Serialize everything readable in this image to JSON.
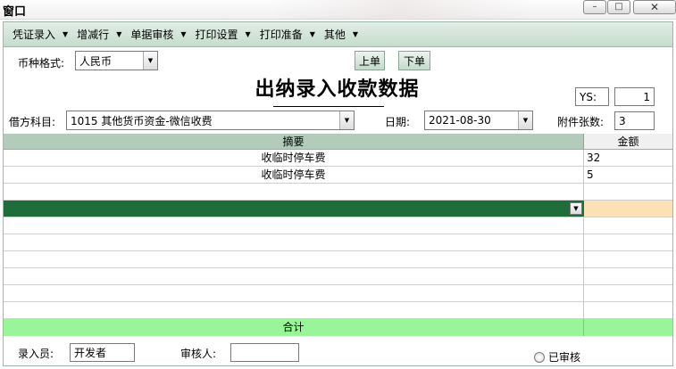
{
  "window": {
    "title": "窗口"
  },
  "menu": {
    "items": [
      {
        "label": "凭证录入"
      },
      {
        "label": "增减行"
      },
      {
        "label": "单据审核"
      },
      {
        "label": "打印设置"
      },
      {
        "label": "打印准备"
      },
      {
        "label": "其他"
      }
    ]
  },
  "header": {
    "currency_label": "币种格式:",
    "currency_value": "人民币",
    "prev_label": "上单",
    "next_label": "下单",
    "page_title": "出纳录入收款数据",
    "ys_label": "YS:",
    "ys_value": "1",
    "debit_label": "借方科目:",
    "debit_value": "1015 其他货币资金-微信收费",
    "date_label": "日期:",
    "date_value": "2021-08-30",
    "attach_label": "附件张数:",
    "attach_value": "3"
  },
  "grid": {
    "columns": [
      "摘要",
      "金额"
    ],
    "rows": [
      {
        "summary": "收临时停车费",
        "amount": "32"
      },
      {
        "summary": "收临时停车费",
        "amount": "5"
      }
    ],
    "total_label": "合计"
  },
  "footer": {
    "entry_label": "录入员:",
    "entry_value": "开发者",
    "reviewer_label": "审核人:",
    "reviewer_value": "",
    "reviewed_label": "已审核"
  },
  "colors": {
    "menu_bg": "#c7dccd",
    "active_row": "#1f6d3a",
    "active_cell": "#fde1b6",
    "total_row": "#98f598"
  }
}
